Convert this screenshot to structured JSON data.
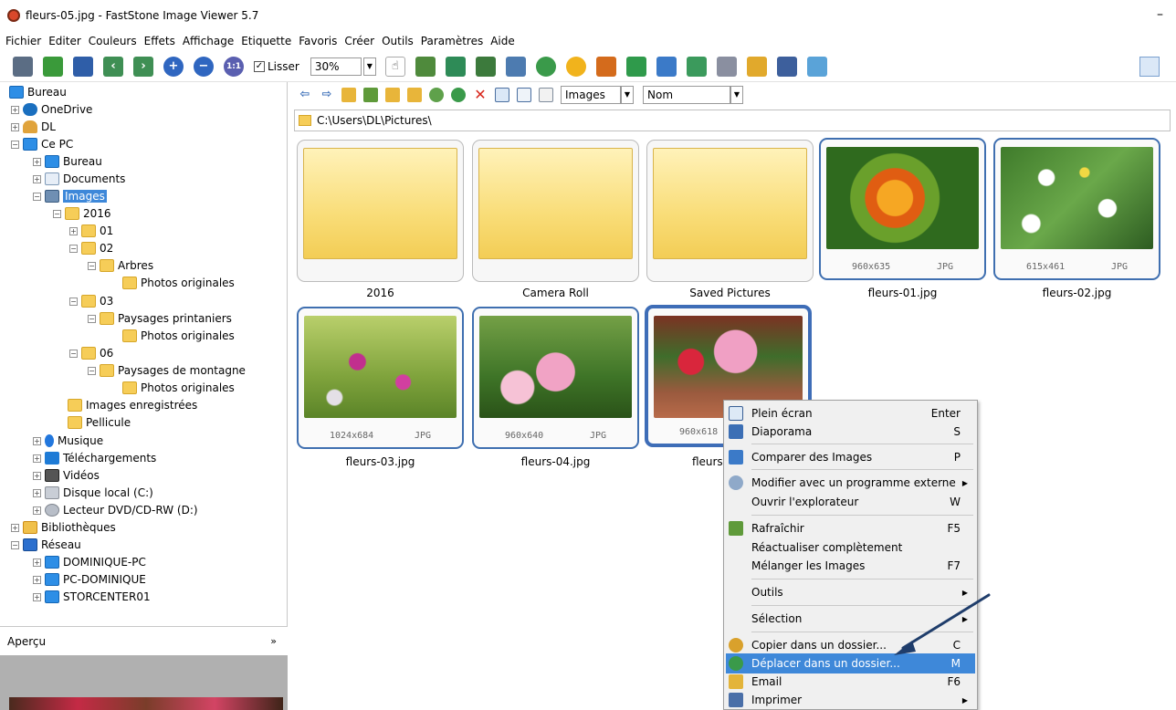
{
  "window": {
    "title": "fleurs-05.jpg  -  FastStone Image Viewer 5.7",
    "minimize": "–"
  },
  "menubar": [
    "Fichier",
    "Editer",
    "Couleurs",
    "Effets",
    "Affichage",
    "Etiquette",
    "Favoris",
    "Créer",
    "Outils",
    "Paramètres",
    "Aide"
  ],
  "toolbar": {
    "lisser_label": "Lisser",
    "lisser_checked": true,
    "zoom": "30%"
  },
  "tree": [
    {
      "label": "Bureau",
      "icon": "monitor-icon"
    },
    {
      "label": "OneDrive",
      "icon": "cloud-icon"
    },
    {
      "label": "DL",
      "icon": "user-icon"
    },
    {
      "label": "Ce PC",
      "icon": "computer-icon"
    },
    {
      "label": "Bureau",
      "icon": "monitor-icon"
    },
    {
      "label": "Documents",
      "icon": "document-icon"
    },
    {
      "label": "Images",
      "icon": "pictures-icon"
    },
    {
      "label": "2016",
      "icon": "folder-icon"
    },
    {
      "label": "01",
      "icon": "folder-icon"
    },
    {
      "label": "02",
      "icon": "folder-icon"
    },
    {
      "label": "Arbres",
      "icon": "folder-icon"
    },
    {
      "label": "Photos originales",
      "icon": "folder-icon"
    },
    {
      "label": "03",
      "icon": "folder-icon"
    },
    {
      "label": "Paysages printaniers",
      "icon": "folder-icon"
    },
    {
      "label": "Photos originales",
      "icon": "folder-icon"
    },
    {
      "label": "06",
      "icon": "folder-icon"
    },
    {
      "label": "Paysages de montagne",
      "icon": "folder-icon"
    },
    {
      "label": "Photos originales",
      "icon": "folder-icon"
    },
    {
      "label": "Images enregistrées",
      "icon": "folder-icon"
    },
    {
      "label": "Pellicule",
      "icon": "folder-icon"
    },
    {
      "label": "Musique",
      "icon": "music-icon"
    },
    {
      "label": "Téléchargements",
      "icon": "download-icon"
    },
    {
      "label": "Vidéos",
      "icon": "video-icon"
    },
    {
      "label": "Disque local (C:)",
      "icon": "disk-icon"
    },
    {
      "label": "Lecteur DVD/CD-RW (D:)",
      "icon": "dvd-icon"
    },
    {
      "label": "Bibliothèques",
      "icon": "library-icon"
    },
    {
      "label": "Réseau",
      "icon": "network-icon"
    },
    {
      "label": "DOMINIQUE-PC",
      "icon": "computer-icon"
    },
    {
      "label": "PC-DOMINIQUE",
      "icon": "computer-icon"
    },
    {
      "label": "STORCENTER01",
      "icon": "computer-icon"
    }
  ],
  "preview": {
    "label": "Aperçu",
    "chevron": "»"
  },
  "browser": {
    "filter": "Images",
    "sort": "Nom",
    "path": "C:\\Users\\DL\\Pictures\\"
  },
  "items": [
    {
      "name": "2016",
      "type": "folder"
    },
    {
      "name": "Camera Roll",
      "type": "folder"
    },
    {
      "name": "Saved Pictures",
      "type": "folder"
    },
    {
      "name": "fleurs-01.jpg",
      "dims": "960x635",
      "ext": "JPG"
    },
    {
      "name": "fleurs-02.jpg",
      "dims": "615x461",
      "ext": "JPG"
    },
    {
      "name": "fleurs-03.jpg",
      "dims": "1024x684",
      "ext": "JPG"
    },
    {
      "name": "fleurs-04.jpg",
      "dims": "960x640",
      "ext": "JPG"
    },
    {
      "name": "fleurs-",
      "dims": "960x618",
      "ext": ""
    }
  ],
  "context_menu": [
    {
      "label": "Plein écran",
      "shortcut": "Enter",
      "icon": "fullscreen-icon"
    },
    {
      "label": "Diaporama",
      "shortcut": "S",
      "icon": "slideshow-icon"
    },
    {
      "label": "Comparer des Images",
      "shortcut": "P",
      "icon": "compare-icon"
    },
    {
      "label": "Modifier avec un programme externe",
      "shortcut": "",
      "icon": "external-edit-icon",
      "submenu": true
    },
    {
      "label": "Ouvrir l'explorateur",
      "shortcut": "W",
      "icon": ""
    },
    {
      "label": "Rafraîchir",
      "shortcut": "F5",
      "icon": "refresh-icon"
    },
    {
      "label": "Réactualiser complètement",
      "shortcut": "",
      "icon": ""
    },
    {
      "label": "Mélanger les Images",
      "shortcut": "F7",
      "icon": ""
    },
    {
      "label": "Outils",
      "shortcut": "",
      "icon": "",
      "submenu": true
    },
    {
      "label": "Sélection",
      "shortcut": "",
      "icon": "",
      "submenu": true
    },
    {
      "label": "Copier dans un dossier...",
      "shortcut": "C",
      "icon": "copy-folder-icon"
    },
    {
      "label": "Déplacer dans un dossier...",
      "shortcut": "M",
      "icon": "move-folder-icon",
      "highlighted": true
    },
    {
      "label": "Email",
      "shortcut": "F6",
      "icon": "email-icon"
    },
    {
      "label": "Imprimer",
      "shortcut": "",
      "icon": "print-icon",
      "submenu": true
    }
  ],
  "colors": {
    "selection": "#3e88d9",
    "thumb_border": "#3f6fb0",
    "arrow": "#1f3d6b"
  }
}
